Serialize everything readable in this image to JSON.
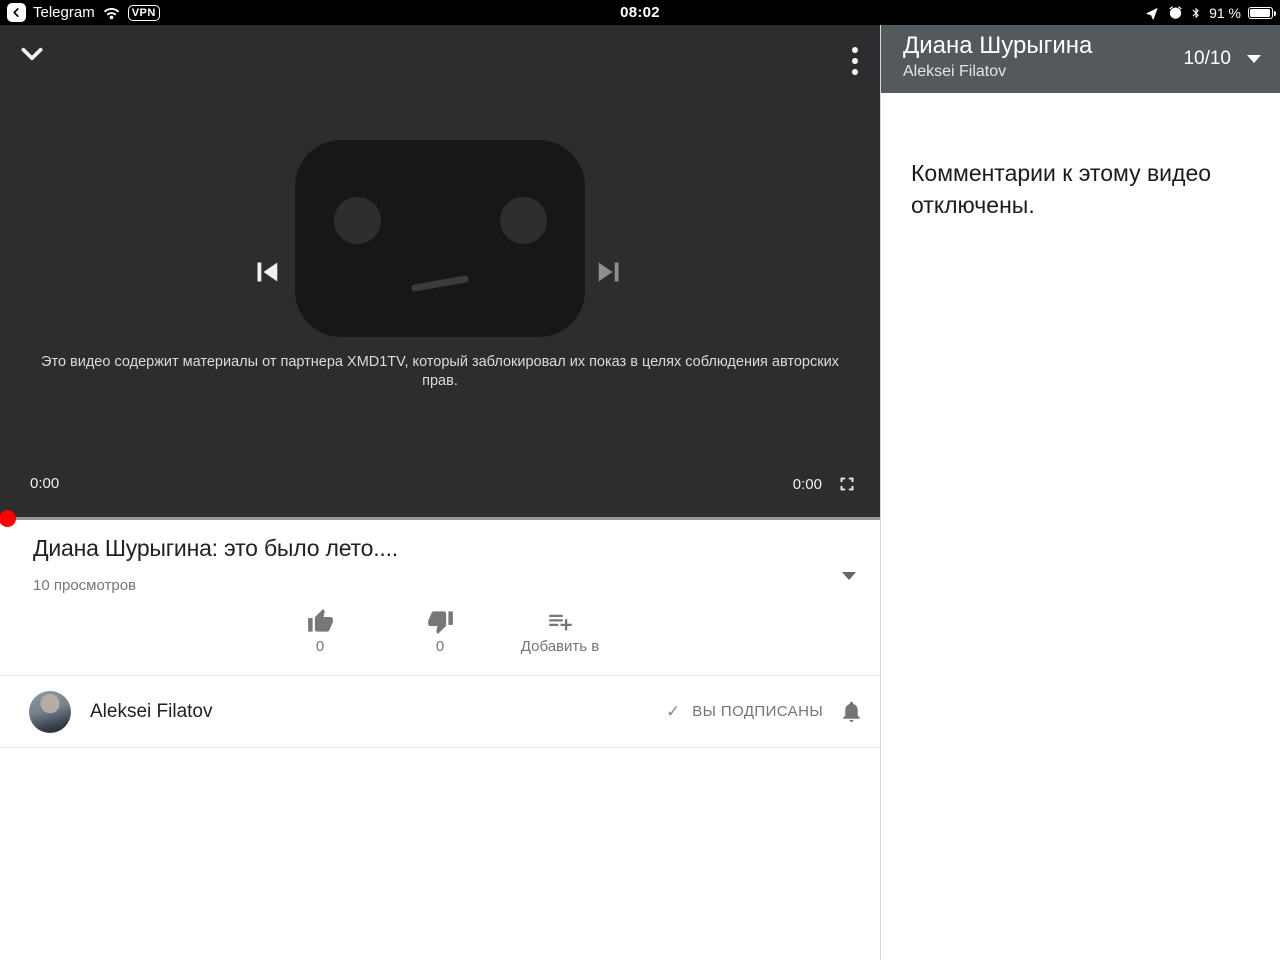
{
  "status_bar": {
    "back_app_label": "Telegram",
    "vpn_badge": "VPN",
    "time": "08:02",
    "battery_percent": "91 %"
  },
  "player": {
    "error_message": "Это видео содержит материалы от партнера XMD1TV, который заблокировал их показ в целях соблюдения авторских прав.",
    "current_time": "0:00",
    "duration": "0:00"
  },
  "video": {
    "title": "Диана Шурыгина: это было лето....",
    "views": "10 просмотров",
    "actions": {
      "like_count": "0",
      "dislike_count": "0",
      "add_to_label": "Добавить в"
    }
  },
  "channel": {
    "name": "Aleksei Filatov",
    "subscribed_check": "✓",
    "subscribed_label": "ВЫ ПОДПИСАНЫ"
  },
  "playlist_panel": {
    "title": "Диана Шурыгина",
    "subtitle": "Aleksei Filatov",
    "position": "10/10",
    "comments_notice": "Комментарии к этому видео отключены."
  },
  "colors": {
    "accent_red": "#fe0000",
    "player_bg": "#2c2d2e",
    "panel_header_bg": "#53595d"
  }
}
